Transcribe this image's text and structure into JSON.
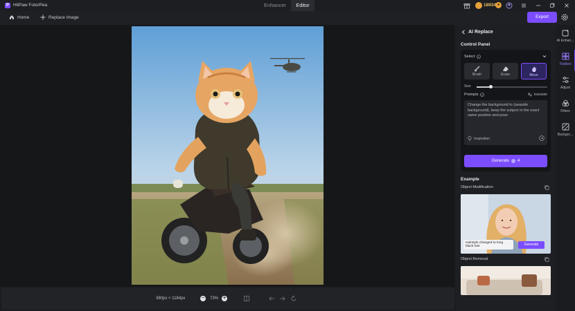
{
  "app": {
    "name": "HitPaw FotorPea",
    "logo_letter": "P",
    "modes": [
      {
        "label": "Enhancer",
        "active": false
      },
      {
        "label": "Editor",
        "active": true
      }
    ],
    "coins": "18934",
    "icons": [
      "coin-icon",
      "add-coins-icon",
      "menu-icon",
      "account-icon",
      "minimize-icon",
      "restore-icon",
      "close-icon"
    ]
  },
  "toolbar": {
    "home_label": "Home",
    "replace_label": "Replace Image",
    "export_label": "Export"
  },
  "canvas": {
    "dimensions": "380px × 1184px",
    "zoom": "73%"
  },
  "panel": {
    "title": "AI Replace",
    "control_panel_label": "Control Panel",
    "select_label": "Select",
    "tools": [
      {
        "label": "Brush",
        "active": false
      },
      {
        "label": "Erase",
        "active": false
      },
      {
        "label": "Move",
        "active": true
      }
    ],
    "size_label": "Size",
    "size_value": 0.2,
    "prompts_label": "Prompts",
    "translate_label": "translate",
    "prompt_text": "Change the background to {seaside background}, keep the subject in the exact same position and pose",
    "inspiration_label": "Inspiration",
    "generate_label": "Generate",
    "generate_cost": "4",
    "example_label": "Example",
    "examples": [
      {
        "label": "Object Modification",
        "caption": "Hairstyle changed to long black hair",
        "button": "Generate"
      },
      {
        "label": "Object Removal"
      }
    ]
  },
  "sidenav": {
    "items": [
      {
        "label": "AI Enhan...",
        "icon": "ai-enhance-icon",
        "active": false
      },
      {
        "label": "Toolbox",
        "icon": "toolbox-icon",
        "active": true
      },
      {
        "label": "Adjust",
        "icon": "adjust-icon",
        "active": false
      },
      {
        "label": "Filters",
        "icon": "filters-icon",
        "active": false
      },
      {
        "label": "Backgro...",
        "icon": "background-icon",
        "active": false
      }
    ]
  },
  "colors": {
    "accent": "#7b4dff",
    "bg": "#1b1c20",
    "panel": "#1e1f23",
    "coin": "#e6a13a"
  }
}
